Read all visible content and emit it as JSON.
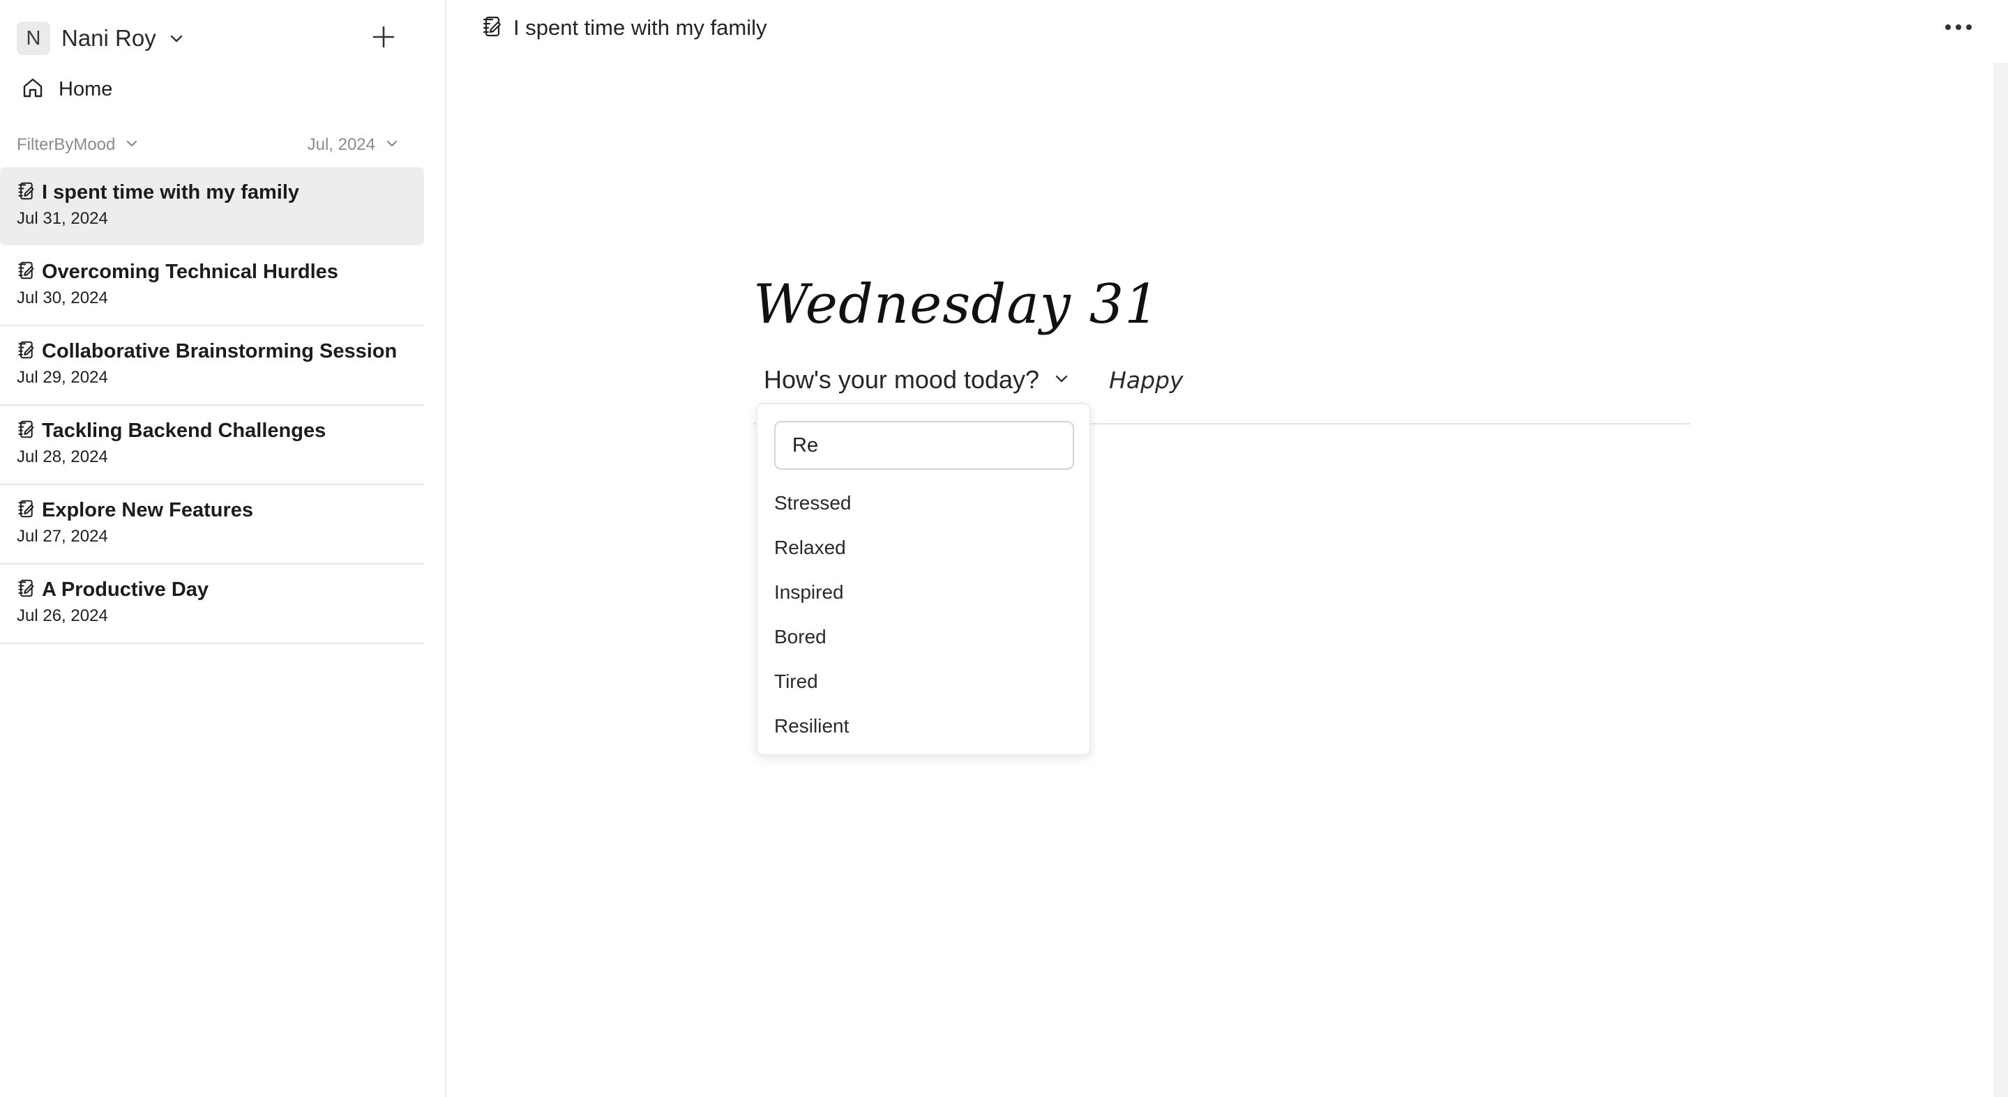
{
  "user": {
    "initial": "N",
    "name": "Nani Roy"
  },
  "nav": {
    "home_label": "Home"
  },
  "filters": {
    "mood_label": "FilterByMood",
    "month_label": "Jul, 2024"
  },
  "entries": [
    {
      "title": "I spent time with my family",
      "date": "Jul 31, 2024",
      "active": true
    },
    {
      "title": "Overcoming Technical Hurdles",
      "date": "Jul 30, 2024"
    },
    {
      "title": "Collaborative Brainstorming Session",
      "date": "Jul 29, 2024"
    },
    {
      "title": "Tackling Backend Challenges",
      "date": "Jul 28, 2024"
    },
    {
      "title": "Explore New Features",
      "date": "Jul 27, 2024"
    },
    {
      "title": "A Productive Day",
      "date": "Jul 26, 2024"
    }
  ],
  "header": {
    "title": "I spent time with my family"
  },
  "editor": {
    "day_heading": "Wednesday 31",
    "mood_prompt": "How's your mood today?",
    "mood_value": "Happy"
  },
  "mood_dropdown": {
    "search_value": "Re",
    "options": [
      "Stressed",
      "Relaxed",
      "Inspired",
      "Bored",
      "Tired",
      "Resilient"
    ]
  },
  "icons": {
    "add": "plus-icon",
    "home": "home-icon",
    "entry": "journal-edit-icon",
    "more": "more-horizontal-icon",
    "chevron": "chevron-down-icon"
  },
  "colors": {
    "active_row": "#ededed",
    "muted_text": "#8b8b8b",
    "divider": "#e6e6e6"
  }
}
